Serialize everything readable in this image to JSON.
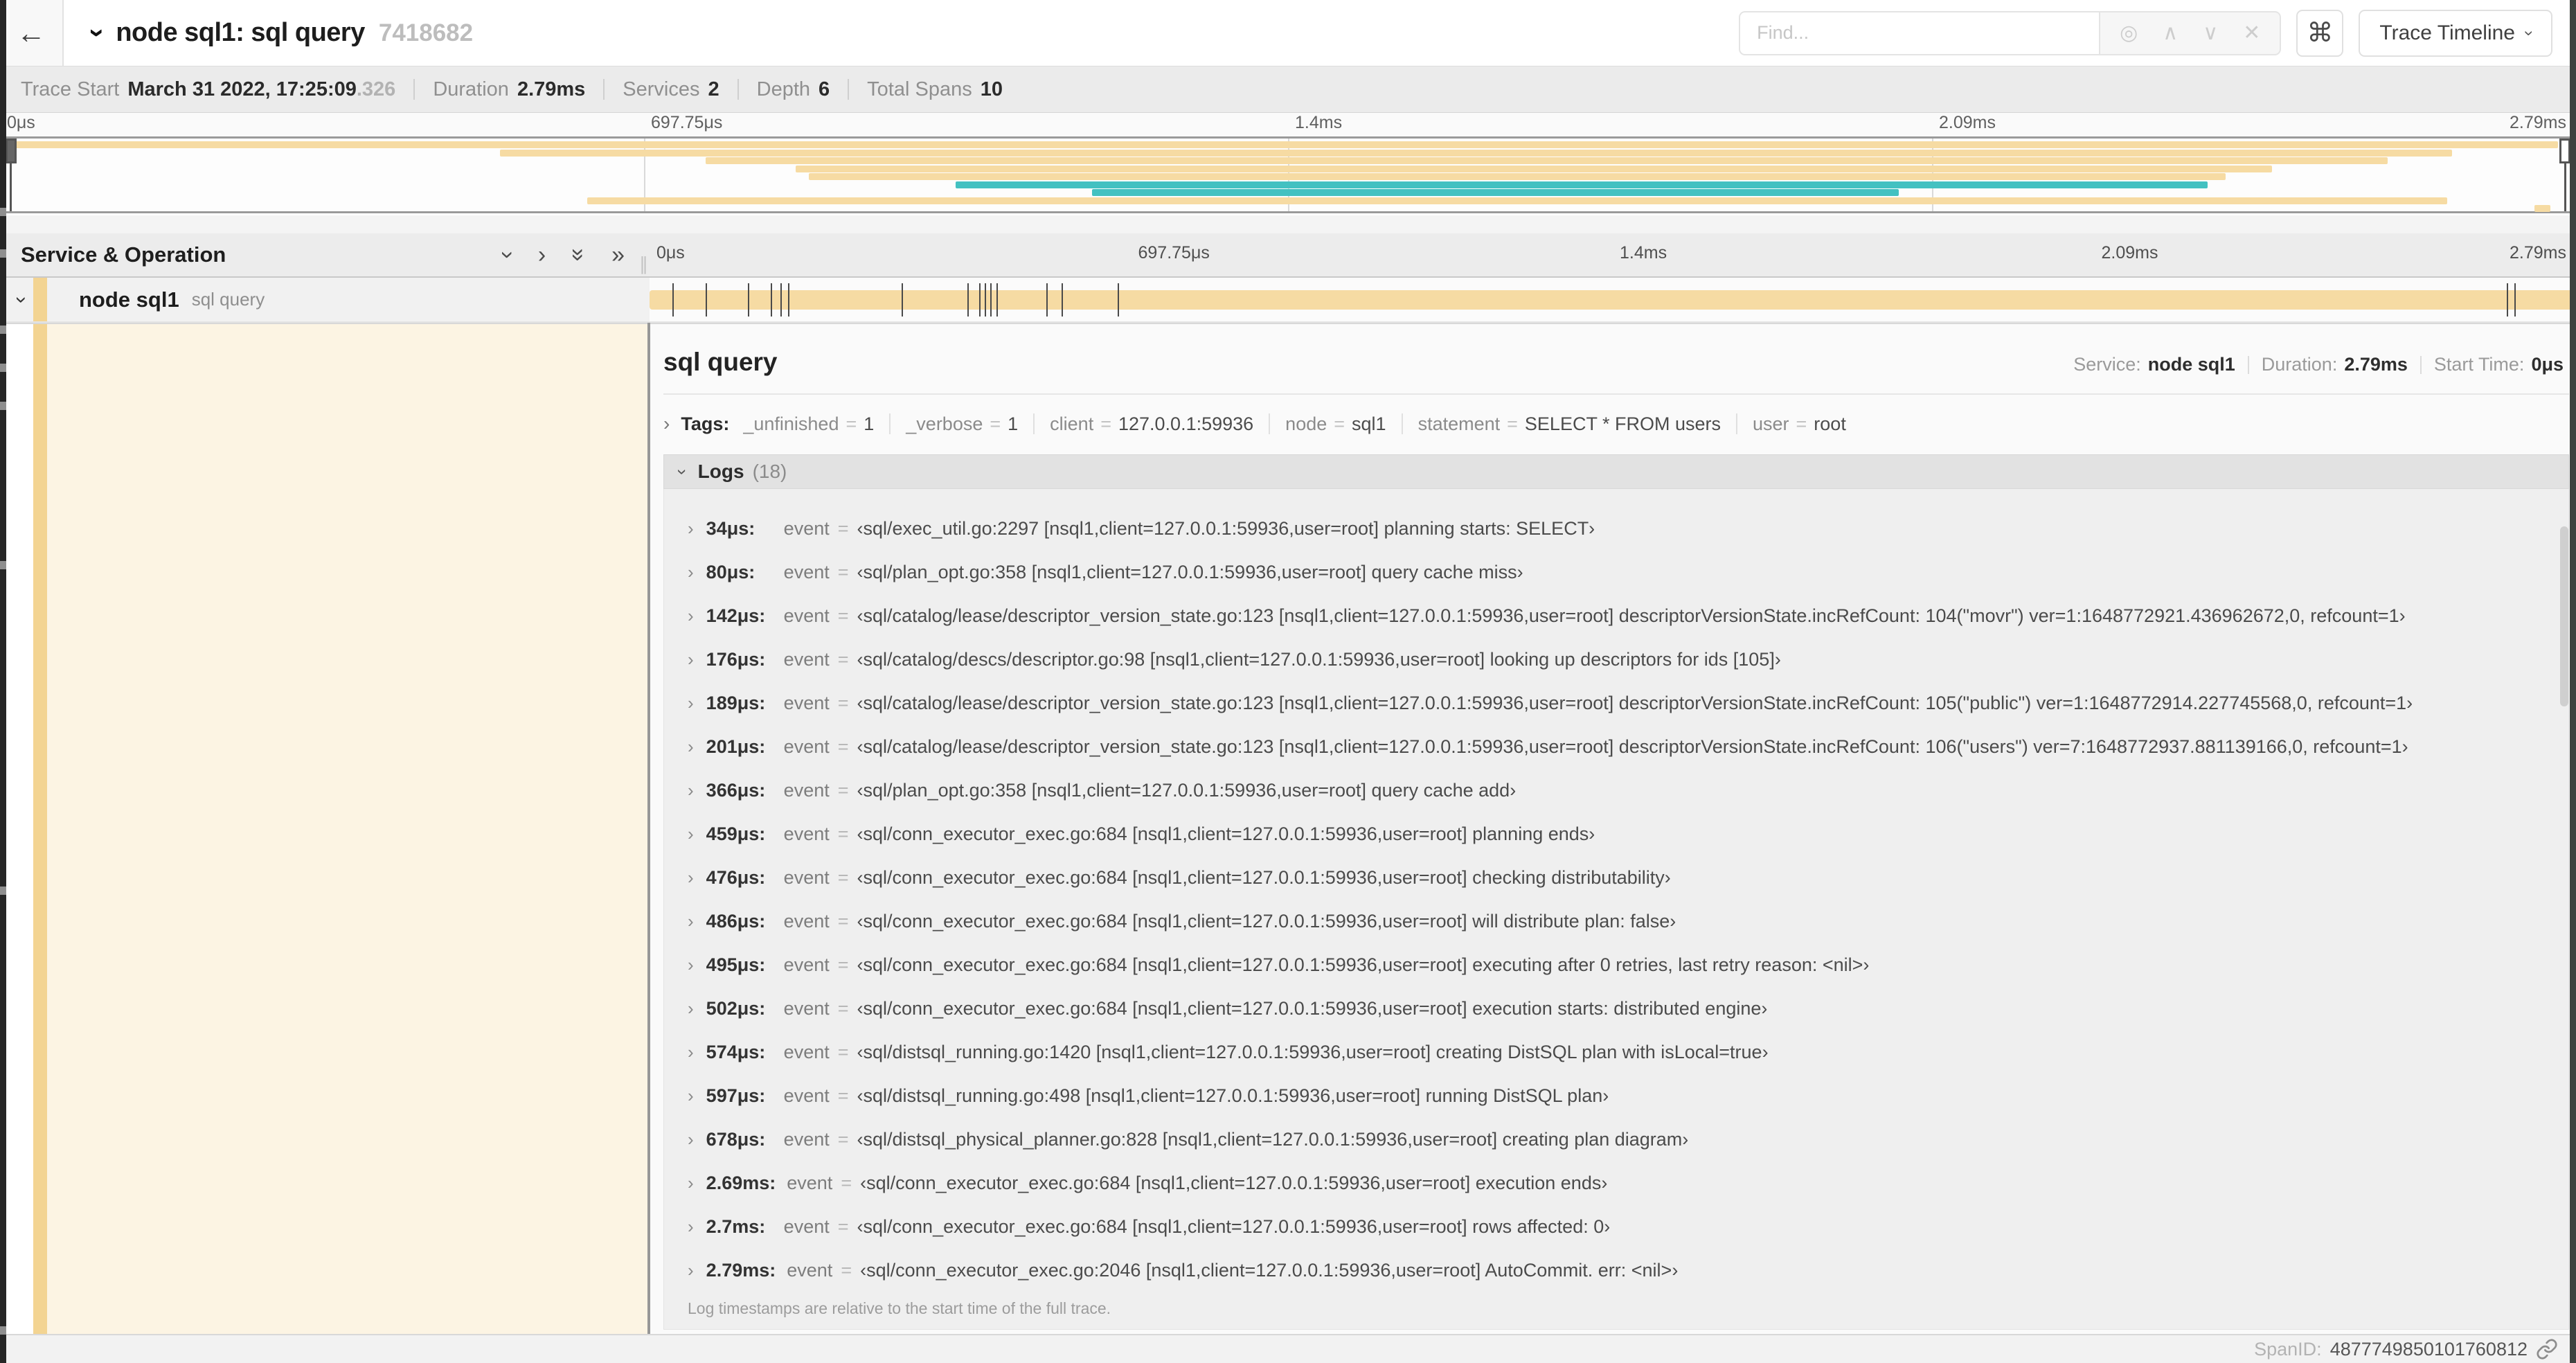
{
  "colors": {
    "tan": "#F6DBA3",
    "teal": "#43C1C1",
    "cream": "#FCF4E3",
    "stripe": "#F3D492"
  },
  "header": {
    "back": "←",
    "collapse_chevron": "›",
    "title": "node sql1: sql query",
    "trace_id": "7418682",
    "find_placeholder": "Find...",
    "shortcut": "⌘",
    "view_selector": "Trace Timeline",
    "find_icons": {
      "target": "◎",
      "prev": "∧",
      "next": "∨",
      "clear": "✕"
    }
  },
  "summary": {
    "items": [
      {
        "label": "Trace Start",
        "value": "March 31 2022, 17:25:09",
        "suffix": ".326"
      },
      {
        "label": "Duration",
        "value": "2.79ms"
      },
      {
        "label": "Services",
        "value": "2"
      },
      {
        "label": "Depth",
        "value": "6"
      },
      {
        "label": "Total Spans",
        "value": "10"
      }
    ]
  },
  "minimap": {
    "ticks": [
      "0μs",
      "697.75μs",
      "1.4ms",
      "2.09ms",
      "2.79ms"
    ],
    "spans": [
      {
        "start": 0.0,
        "end": 99.3,
        "color": "tan"
      },
      {
        "start": 19.4,
        "end": 95.2,
        "color": "tan"
      },
      {
        "start": 27.4,
        "end": 92.7,
        "color": "tan"
      },
      {
        "start": 30.9,
        "end": 88.2,
        "color": "tan"
      },
      {
        "start": 31.4,
        "end": 86.4,
        "color": "tan"
      },
      {
        "start": 37.1,
        "end": 85.7,
        "color": "teal"
      },
      {
        "start": 42.4,
        "end": 73.7,
        "color": "teal"
      },
      {
        "start": 22.8,
        "end": 95.0,
        "color": "tan"
      },
      {
        "start": 98.4,
        "end": 99.0,
        "color": "tan"
      }
    ]
  },
  "timeline": {
    "header_title": "Service & Operation",
    "ticks": [
      "0μs",
      "697.75μs",
      "1.4ms",
      "2.09ms",
      "2.79ms"
    ],
    "row": {
      "service": "node sql1",
      "operation": "sql query",
      "bar_start": 0,
      "bar_end": 100,
      "log_marks": [
        1.2,
        2.9,
        5.1,
        6.3,
        6.8,
        7.2,
        13.1,
        16.5,
        17.1,
        17.4,
        17.7,
        18.0,
        20.6,
        21.4,
        24.3,
        96.4,
        96.8
      ]
    }
  },
  "detail": {
    "title": "sql query",
    "meta": [
      {
        "label": "Service:",
        "value": "node sql1"
      },
      {
        "label": "Duration:",
        "value": "2.79ms"
      },
      {
        "label": "Start Time:",
        "value": "0μs"
      }
    ],
    "tags": {
      "label": "Tags:",
      "items": [
        {
          "key": "_unfinished",
          "value": "1"
        },
        {
          "key": "_verbose",
          "value": "1"
        },
        {
          "key": "client",
          "value": "127.0.0.1:59936"
        },
        {
          "key": "node",
          "value": "sql1"
        },
        {
          "key": "statement",
          "value": "SELECT * FROM users"
        },
        {
          "key": "user",
          "value": "root"
        }
      ]
    },
    "logs": {
      "label": "Logs",
      "count": "(18)",
      "entries": [
        {
          "time": "34μs:",
          "field": "event",
          "value": "‹sql/exec_util.go:2297 [nsql1,client=127.0.0.1:59936,user=root] planning starts: SELECT›"
        },
        {
          "time": "80μs:",
          "field": "event",
          "value": "‹sql/plan_opt.go:358 [nsql1,client=127.0.0.1:59936,user=root] query cache miss›"
        },
        {
          "time": "142μs:",
          "field": "event",
          "value": "‹sql/catalog/lease/descriptor_version_state.go:123 [nsql1,client=127.0.0.1:59936,user=root] descriptorVersionState.incRefCount: 104(\"movr\") ver=1:1648772921.436962672,0, refcount=1›"
        },
        {
          "time": "176μs:",
          "field": "event",
          "value": "‹sql/catalog/descs/descriptor.go:98 [nsql1,client=127.0.0.1:59936,user=root] looking up descriptors for ids [105]›"
        },
        {
          "time": "189μs:",
          "field": "event",
          "value": "‹sql/catalog/lease/descriptor_version_state.go:123 [nsql1,client=127.0.0.1:59936,user=root] descriptorVersionState.incRefCount: 105(\"public\") ver=1:1648772914.227745568,0, refcount=1›"
        },
        {
          "time": "201μs:",
          "field": "event",
          "value": "‹sql/catalog/lease/descriptor_version_state.go:123 [nsql1,client=127.0.0.1:59936,user=root] descriptorVersionState.incRefCount: 106(\"users\") ver=7:1648772937.881139166,0, refcount=1›"
        },
        {
          "time": "366μs:",
          "field": "event",
          "value": "‹sql/plan_opt.go:358 [nsql1,client=127.0.0.1:59936,user=root] query cache add›"
        },
        {
          "time": "459μs:",
          "field": "event",
          "value": "‹sql/conn_executor_exec.go:684 [nsql1,client=127.0.0.1:59936,user=root] planning ends›"
        },
        {
          "time": "476μs:",
          "field": "event",
          "value": "‹sql/conn_executor_exec.go:684 [nsql1,client=127.0.0.1:59936,user=root] checking distributability›"
        },
        {
          "time": "486μs:",
          "field": "event",
          "value": "‹sql/conn_executor_exec.go:684 [nsql1,client=127.0.0.1:59936,user=root] will distribute plan: false›"
        },
        {
          "time": "495μs:",
          "field": "event",
          "value": "‹sql/conn_executor_exec.go:684 [nsql1,client=127.0.0.1:59936,user=root] executing after 0 retries, last retry reason: <nil>›"
        },
        {
          "time": "502μs:",
          "field": "event",
          "value": "‹sql/conn_executor_exec.go:684 [nsql1,client=127.0.0.1:59936,user=root] execution starts: distributed engine›"
        },
        {
          "time": "574μs:",
          "field": "event",
          "value": "‹sql/distsql_running.go:1420 [nsql1,client=127.0.0.1:59936,user=root] creating DistSQL plan with isLocal=true›"
        },
        {
          "time": "597μs:",
          "field": "event",
          "value": "‹sql/distsql_running.go:498 [nsql1,client=127.0.0.1:59936,user=root] running DistSQL plan›"
        },
        {
          "time": "678μs:",
          "field": "event",
          "value": "‹sql/distsql_physical_planner.go:828 [nsql1,client=127.0.0.1:59936,user=root] creating plan diagram›"
        },
        {
          "time": "2.69ms:",
          "field": "event",
          "value": "‹sql/conn_executor_exec.go:684 [nsql1,client=127.0.0.1:59936,user=root] execution ends›"
        },
        {
          "time": "2.7ms:",
          "field": "event",
          "value": "‹sql/conn_executor_exec.go:684 [nsql1,client=127.0.0.1:59936,user=root] rows affected: 0›"
        },
        {
          "time": "2.79ms:",
          "field": "event",
          "value": "‹sql/conn_executor_exec.go:2046 [nsql1,client=127.0.0.1:59936,user=root] AutoCommit. err: <nil>›"
        }
      ],
      "footnote": "Log timestamps are relative to the start time of the full trace."
    },
    "span_id_label": "SpanID:",
    "span_id": "4877749850101760812"
  }
}
